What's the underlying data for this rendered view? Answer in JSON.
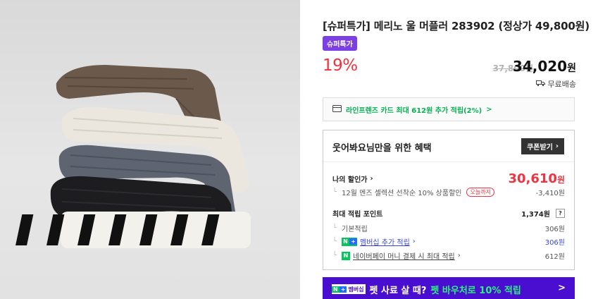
{
  "product": {
    "title": "[슈퍼특가] 메리노 울 머플러 283902 (정상가 49,800원)",
    "badge": "슈퍼특가",
    "discount_rate": "19%",
    "original_price": "37,800원",
    "price": "34,020",
    "currency": "원",
    "shipping": "무료배송"
  },
  "card_banner": {
    "text": "라인프렌즈 카드 최대 612원 추가 적립(2%)",
    "arrow": ">"
  },
  "benefit": {
    "heading": "웃어봐요님만을 위한 혜택",
    "coupon_button": "쿠폰받기",
    "my_price_label": "나의 할인가",
    "my_price_value": "30,610",
    "my_price_currency": "원",
    "discount_detail": "12월 멘즈 셀렉션 선착순 10% 상품할인",
    "today_tag": "오늘까지",
    "discount_amount": "-3,410원",
    "points_label": "최대 적립 포인트",
    "points_total": "1,374원",
    "points_help": "?",
    "basic_label": "기본적립",
    "basic_value": "306원",
    "membership_label": "멤버십 추가 적립",
    "membership_value": "306원",
    "naverpay_label": "네이버페이 머니 결제 시 최대 적립",
    "naverpay_value": "612원"
  },
  "promo": {
    "badge_text": "멤버십",
    "text_white": "펫 사료 살 때?",
    "text_green": "펫 바우처로 10% 적립",
    "arrow": ">"
  },
  "colors": {
    "accent_red": "#ef3340",
    "naver_green": "#03c75a",
    "super_badge": "#7b3fe4",
    "promo_bg": "#4a0ed0"
  }
}
